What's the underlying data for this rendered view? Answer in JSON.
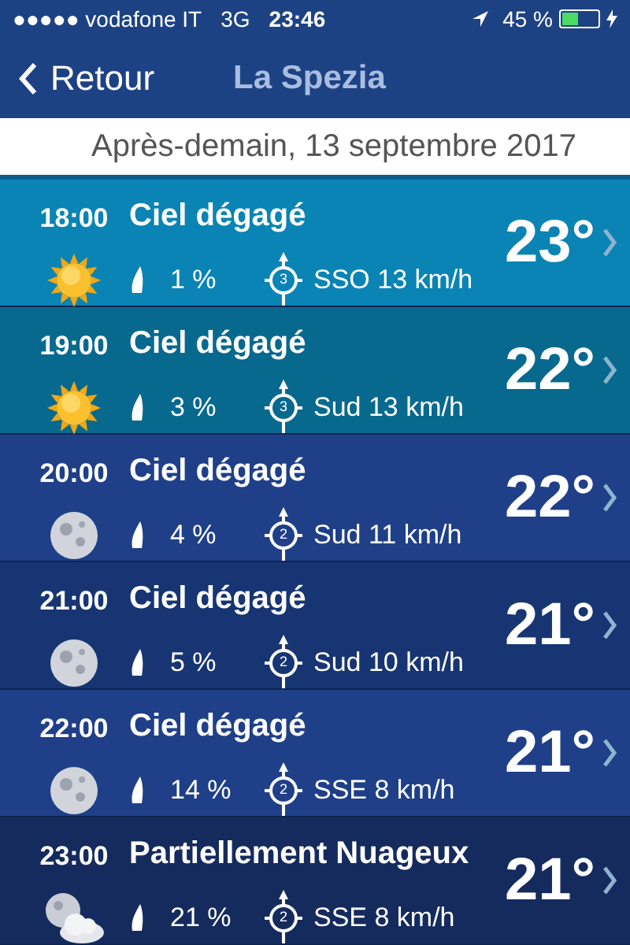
{
  "status_bar": {
    "carrier": "●●●●● vodafone IT",
    "network": "3G",
    "time": "23:46",
    "battery": "45 %"
  },
  "nav": {
    "back": "Retour",
    "title": "La Spezia"
  },
  "date": "Après-demain, 13 septembre 2017",
  "rows": [
    {
      "time": "18:00",
      "condition": "Ciel dégagé",
      "kind": "sun",
      "rain": "1 %",
      "force": "3",
      "wind": "SSO 13 km/h",
      "temp": "23°",
      "color": "#0a84b4"
    },
    {
      "time": "19:00",
      "condition": "Ciel dégagé",
      "kind": "sun",
      "rain": "3 %",
      "force": "3",
      "wind": "Sud 13 km/h",
      "temp": "22°",
      "color": "#08698f"
    },
    {
      "time": "20:00",
      "condition": "Ciel dégagé",
      "kind": "moon",
      "rain": "4 %",
      "force": "2",
      "wind": "Sud 11 km/h",
      "temp": "22°",
      "color": "#1f4088"
    },
    {
      "time": "21:00",
      "condition": "Ciel dégagé",
      "kind": "moon",
      "rain": "5 %",
      "force": "2",
      "wind": "Sud 10 km/h",
      "temp": "21°",
      "color": "#173572"
    },
    {
      "time": "22:00",
      "condition": "Ciel dégagé",
      "kind": "moon",
      "rain": "14 %",
      "force": "2",
      "wind": "SSE 8 km/h",
      "temp": "21°",
      "color": "#1f4088"
    },
    {
      "time": "23:00",
      "condition": "Partiellement Nuageux",
      "kind": "cloud-moon",
      "rain": "21 %",
      "force": "2",
      "wind": "SSE 8 km/h",
      "temp": "21°",
      "color": "#152b5e"
    }
  ]
}
